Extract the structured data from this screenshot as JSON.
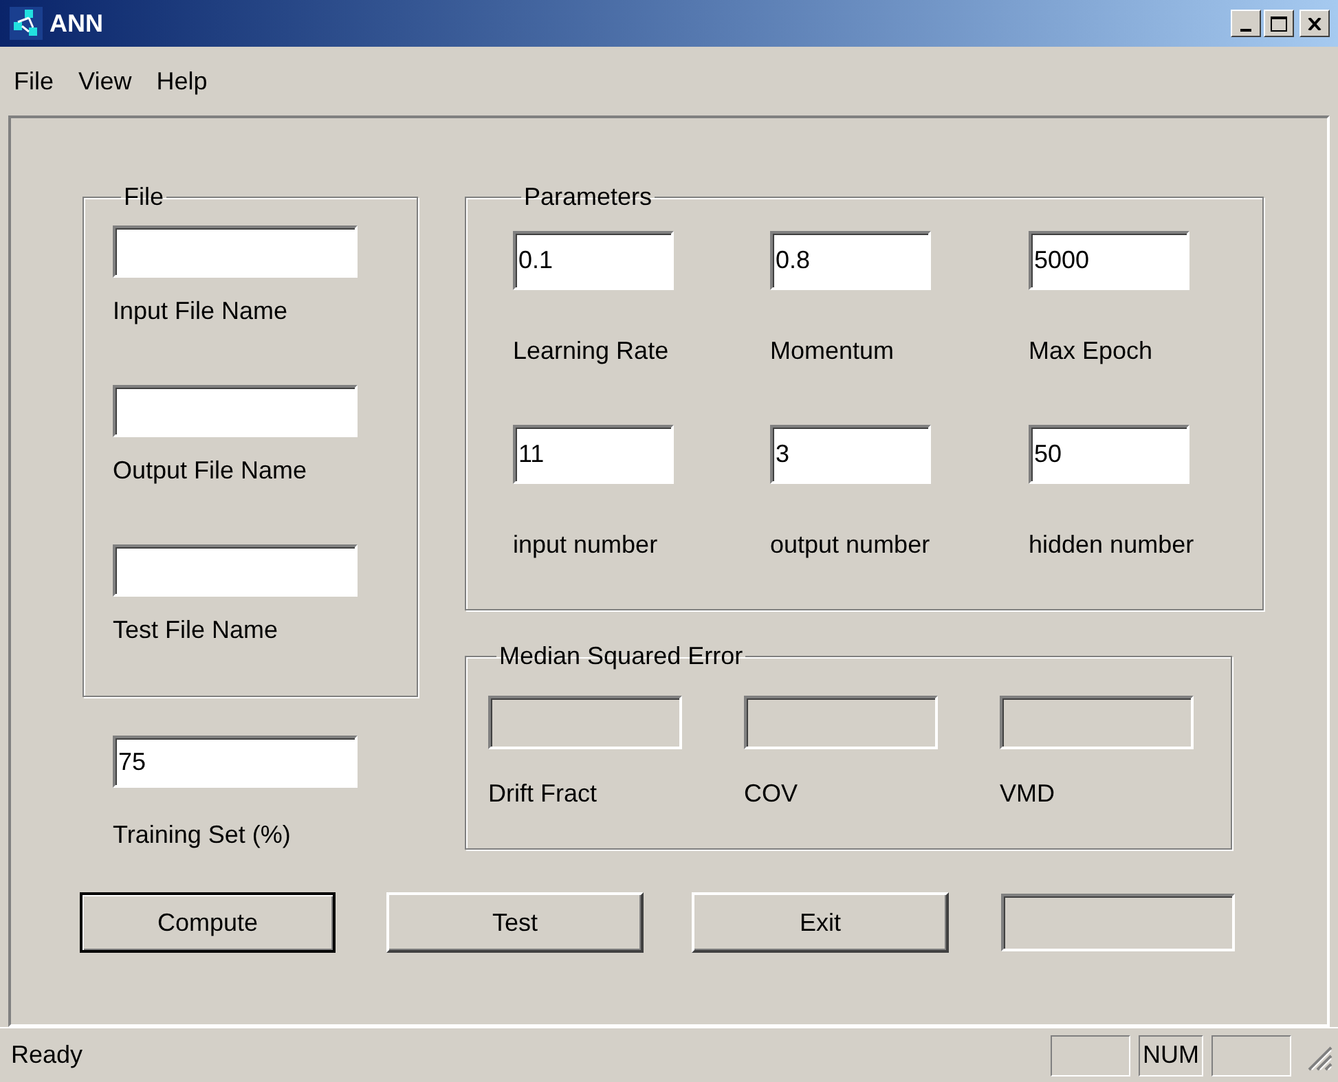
{
  "window": {
    "title": "ANN"
  },
  "menu": [
    "File",
    "View",
    "Help"
  ],
  "file_group": {
    "title": "File",
    "fields": [
      {
        "label": "Input File Name"
      },
      {
        "label": "Output File Name"
      },
      {
        "label": "Test File Name"
      }
    ]
  },
  "training_set": {
    "label": "Training Set (%)",
    "value": "75"
  },
  "parameters": {
    "title": "Parameters",
    "fields": [
      {
        "value": "0.1",
        "label": "Learning Rate"
      },
      {
        "value": "0.8",
        "label": "Momentum"
      },
      {
        "value": "5000",
        "label": "Max Epoch"
      },
      {
        "value": "11",
        "label": "input number"
      },
      {
        "value": "3",
        "label": "output number"
      },
      {
        "value": "50",
        "label": "hidden number"
      }
    ]
  },
  "median_squared_error": {
    "title": "Median Squared Error",
    "fields": [
      {
        "label": "Drift Fract",
        "disabled": true
      },
      {
        "label": "COV",
        "disabled": true
      },
      {
        "label": "VMD",
        "disabled": true
      }
    ]
  },
  "buttons": [
    {
      "label": "Compute",
      "default": true
    },
    {
      "label": "Test",
      "default": false
    },
    {
      "label": "Exit",
      "default": false
    }
  ],
  "result_field": {
    "disabled": true
  },
  "status_bar": {
    "text": "Ready",
    "indicators": [
      {
        "kind": "empty"
      },
      {
        "kind": "text",
        "label": "NUM"
      },
      {
        "kind": "empty"
      }
    ]
  }
}
